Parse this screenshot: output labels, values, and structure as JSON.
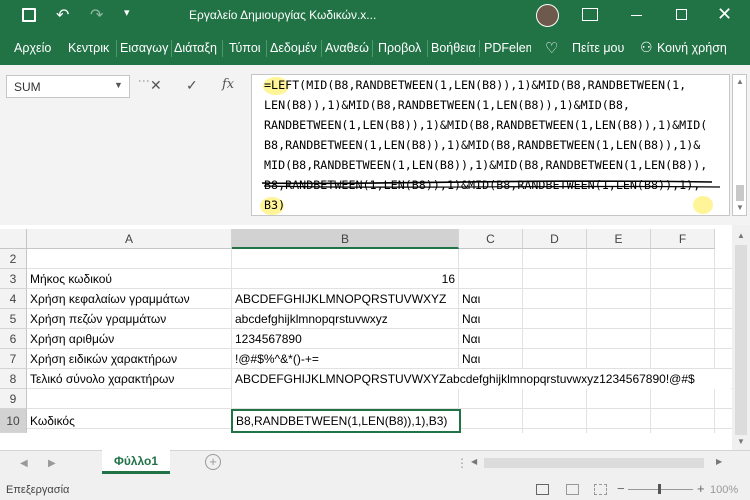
{
  "window": {
    "title": "Εργαλείο Δημιουργίας Κωδικών.x...",
    "tell_me": "Πείτε μου",
    "share": "Κοινή χρήση"
  },
  "ribbon": {
    "tabs": [
      "Αρχείο",
      "Κεντρικ",
      "Εισαγωγ",
      "Διάταξη",
      "Τύποι",
      "Δεδομέν",
      "Αναθεώ",
      "Προβολ",
      "Βοήθεια",
      "PDFelem"
    ]
  },
  "formula_bar": {
    "name_box": "SUM",
    "fx": "fx",
    "lines": [
      "=LEFT(MID(B8,RANDBETWEEN(1,LEN(B8)),1)&MID(B8,RANDBETWEEN(1,",
      "LEN(B8)),1)&MID(B8,RANDBETWEEN(1,LEN(B8)),1)&MID(B8,",
      "RANDBETWEEN(1,LEN(B8)),1)&MID(B8,RANDBETWEEN(1,LEN(B8)),1)&MID(",
      "B8,RANDBETWEEN(1,LEN(B8)),1)&MID(B8,RANDBETWEEN(1,LEN(B8)),1)&",
      "MID(B8,RANDBETWEEN(1,LEN(B8)),1)&MID(B8,RANDBETWEEN(1,LEN(B8)),",
      "B8,RANDBETWEEN(1,LEN(B8)),1)&MID(B8,RANDBETWEEN(1,LEN(B8)),1),",
      "B3)"
    ]
  },
  "grid": {
    "columns": [
      "A",
      "B",
      "C",
      "D",
      "E",
      "F"
    ],
    "rows": [
      {
        "num": "2",
        "a": "",
        "b": "",
        "c": ""
      },
      {
        "num": "3",
        "a": "Μήκος κωδικού",
        "b": "16",
        "c": ""
      },
      {
        "num": "4",
        "a": "Χρήση κεφαλαίων γραμμάτων",
        "b": "ABCDEFGHIJKLMNOPQRSTUVWXYZ",
        "c": "Ναι"
      },
      {
        "num": "5",
        "a": "Χρήση πεζών γραμμάτων",
        "b": "abcdefghijklmnopqrstuvwxyz",
        "c": "Ναι"
      },
      {
        "num": "6",
        "a": "Χρήση αριθμών",
        "b": "1234567890",
        "c": "Ναι"
      },
      {
        "num": "7",
        "a": "Χρήση ειδικών χαρακτήρων",
        "b": "!@#$%^&*()-+=",
        "c": "Ναι"
      },
      {
        "num": "8",
        "a": "Τελικό σύνολο χαρακτήρων",
        "b": "ABCDEFGHIJKLMNOPQRSTUVWXYZabcdefghijklmnopqrstuvwxyz1234567890!@#$",
        "c": ""
      },
      {
        "num": "9",
        "a": "",
        "b": "",
        "c": ""
      },
      {
        "num": "10",
        "a": "Κωδικός",
        "b": "B8,RANDBETWEEN(1,LEN(B8)),1),B3)",
        "c": ""
      }
    ]
  },
  "sheets": {
    "active": "Φύλλο1"
  },
  "status": {
    "mode": "Επεξεργασία",
    "zoom": "100%"
  }
}
